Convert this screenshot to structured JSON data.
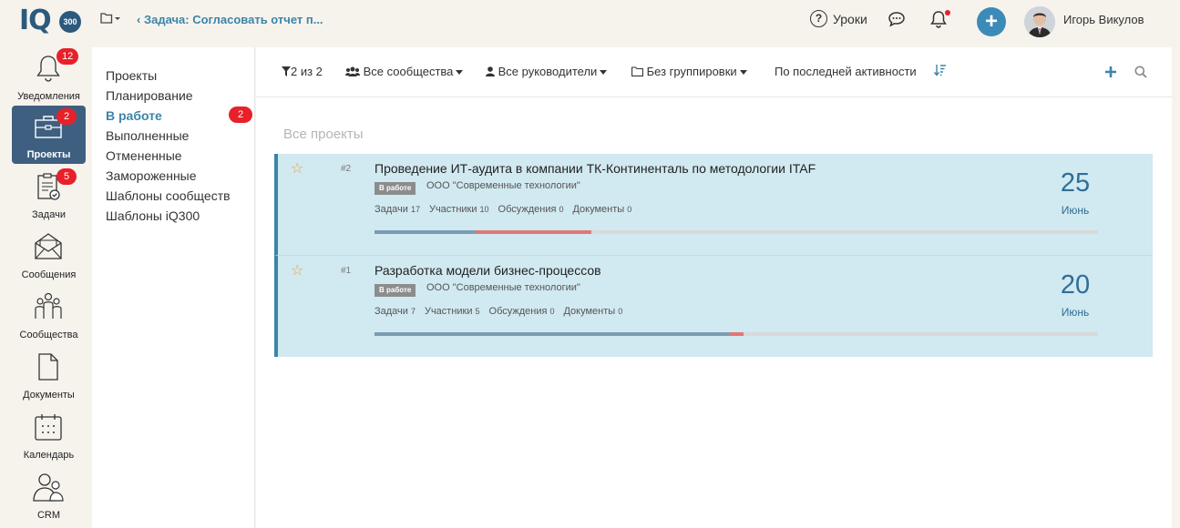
{
  "logo": {
    "text": "IQ",
    "badge": "300"
  },
  "header": {
    "breadcrumb": "‹ Задача: Согласовать отчет п...",
    "help_label": "Уроки",
    "user_name": "Игорь Викулов",
    "plus_label": "+"
  },
  "leftnav": {
    "items": [
      {
        "label": "Уведомления",
        "badge": "12",
        "icon": "bell-icon"
      },
      {
        "label": "Проекты",
        "badge": "2",
        "icon": "briefcase-icon",
        "active": true
      },
      {
        "label": "Задачи",
        "badge": "5",
        "icon": "clipboard-icon"
      },
      {
        "label": "Сообщения",
        "icon": "envelope-icon"
      },
      {
        "label": "Сообщества",
        "icon": "people-icon"
      },
      {
        "label": "Документы",
        "icon": "document-icon"
      },
      {
        "label": "Календарь",
        "icon": "calendar-icon"
      },
      {
        "label": "CRM",
        "icon": "crm-people-icon"
      }
    ]
  },
  "submenu": {
    "items": [
      {
        "label": "Проекты"
      },
      {
        "label": "Планирование"
      },
      {
        "label": "В работе",
        "active": true,
        "badge": "2"
      },
      {
        "label": "Выполненные"
      },
      {
        "label": "Отмененные"
      },
      {
        "label": "Замороженные"
      },
      {
        "label": "Шаблоны сообществ"
      },
      {
        "label": "Шаблоны iQ300"
      }
    ]
  },
  "toolbar": {
    "filter": "2 из 2",
    "communities": "Все сообщества",
    "managers": "Все руководители",
    "grouping": "Без группировки",
    "sort": "По последней активности"
  },
  "main": {
    "section_title": "Все проекты",
    "projects": [
      {
        "num": "#2",
        "title": "Проведение ИТ-аудита в компании ТК-Континенталь по методологии ITAF",
        "status": "В работе",
        "company": "ООО \"Современные технологии\"",
        "stats": [
          {
            "label": "Задачи",
            "value": "17"
          },
          {
            "label": "Участники",
            "value": "10"
          },
          {
            "label": "Обсуждения",
            "value": "0"
          },
          {
            "label": "Документы",
            "value": "0"
          }
        ],
        "progress_done": 0.14,
        "progress_late": 0.16,
        "day": "25",
        "month": "Июнь"
      },
      {
        "num": "#1",
        "title": "Разработка модели бизнес-процессов",
        "status": "В работе",
        "company": "ООО \"Современные технологии\"",
        "stats": [
          {
            "label": "Задачи",
            "value": "7"
          },
          {
            "label": "Участники",
            "value": "5"
          },
          {
            "label": "Обсуждения",
            "value": "0"
          },
          {
            "label": "Документы",
            "value": "0"
          }
        ],
        "progress_done": 0.49,
        "progress_late": 0.02,
        "day": "20",
        "month": "Июнь"
      }
    ]
  },
  "colors": {
    "accent": "#3b85a8",
    "nav_active": "#3e5f80",
    "badge": "#e8202a",
    "card_bg": "#d1e9f1",
    "progress_done": "#7a9cb1",
    "progress_late": "#e27775"
  }
}
